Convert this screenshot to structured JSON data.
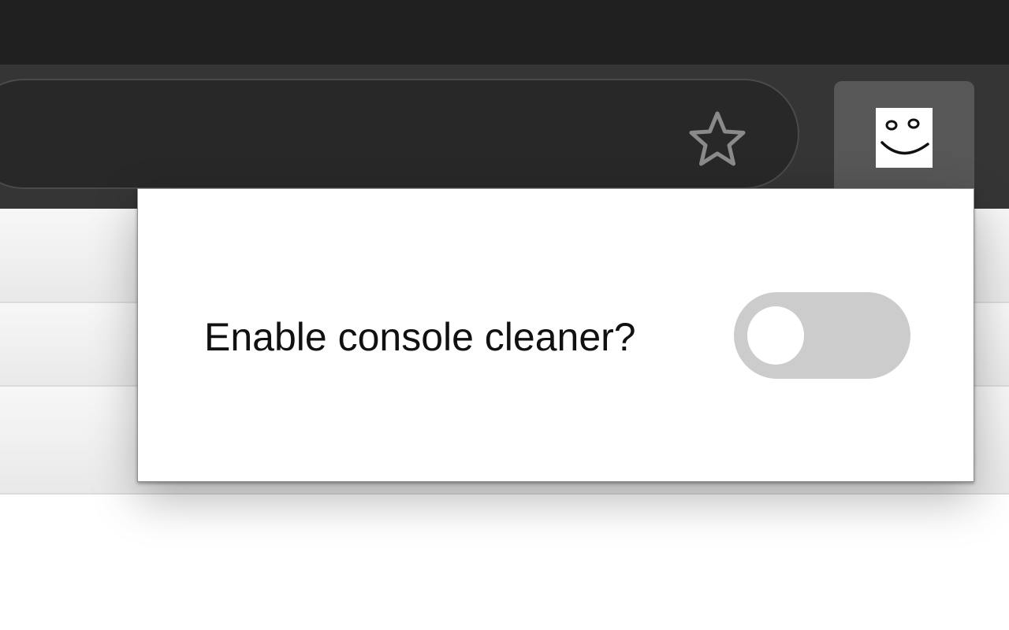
{
  "browser": {
    "bookmark_icon": "star-outline-icon",
    "extension_icon": "smiley-face-icon"
  },
  "popup": {
    "label": "Enable console cleaner?",
    "toggle": {
      "enabled": false
    }
  },
  "colors": {
    "titlebar": "#202020",
    "toolbar": "#353535",
    "omnibox": "#282828",
    "extension_button": "#575757",
    "toggle_off_track": "#cccccc",
    "toggle_knob": "#ffffff"
  }
}
